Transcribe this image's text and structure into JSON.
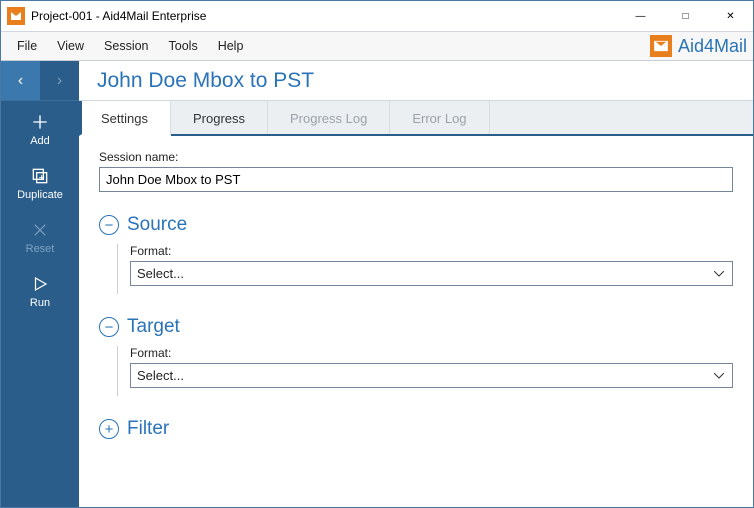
{
  "window": {
    "title": "Project-001 - Aid4Mail Enterprise"
  },
  "menu": {
    "items": [
      "File",
      "View",
      "Session",
      "Tools",
      "Help"
    ],
    "brand": "Aid4Mail"
  },
  "sidebar": {
    "actions": {
      "add": "Add",
      "duplicate": "Duplicate",
      "reset": "Reset",
      "run": "Run"
    }
  },
  "session": {
    "title": "John Doe Mbox to PST"
  },
  "tabs": {
    "settings": "Settings",
    "progress": "Progress",
    "progress_log": "Progress Log",
    "error_log": "Error Log"
  },
  "settings": {
    "session_name_label": "Session name:",
    "session_name_value": "John Doe Mbox to PST",
    "source": {
      "title": "Source",
      "format_label": "Format:",
      "format_value": "Select..."
    },
    "target": {
      "title": "Target",
      "format_label": "Format:",
      "format_value": "Select..."
    },
    "filter": {
      "title": "Filter"
    }
  }
}
